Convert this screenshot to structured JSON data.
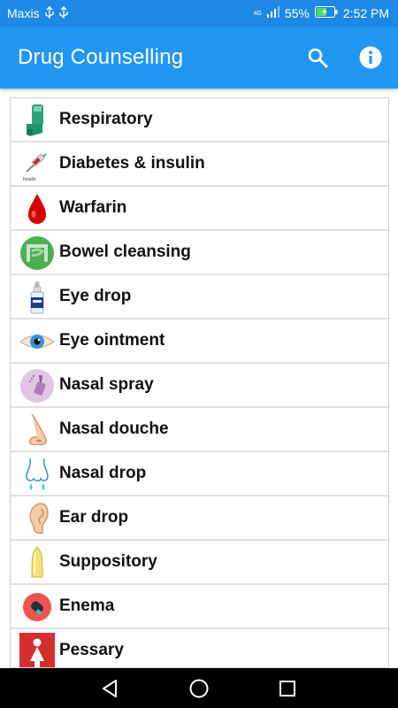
{
  "status_bar": {
    "carrier": "Maxis",
    "network_label": "4G",
    "battery_percent": "55%",
    "time": "2:52 PM",
    "icons": [
      "usb-icon",
      "usb-icon",
      "signal-icon",
      "battery-charging-icon"
    ]
  },
  "app_bar": {
    "title": "Drug Counselling",
    "background": "#2196F3",
    "actions": [
      "search-icon",
      "info-icon"
    ]
  },
  "list": {
    "items": [
      {
        "label": "Respiratory",
        "icon": "inhaler-icon"
      },
      {
        "label": "Diabetes & insulin",
        "icon": "insulin-syringe-icon",
        "icon_caption": "Insulin"
      },
      {
        "label": "Warfarin",
        "icon": "blood-drop-icon"
      },
      {
        "label": "Bowel cleansing",
        "icon": "intestine-icon"
      },
      {
        "label": "Eye drop",
        "icon": "eye-drop-bottle-icon"
      },
      {
        "label": "Eye ointment",
        "icon": "eye-icon"
      },
      {
        "label": "Nasal spray",
        "icon": "nasal-spray-icon"
      },
      {
        "label": "Nasal douche",
        "icon": "nose-icon"
      },
      {
        "label": "Nasal drop",
        "icon": "nose-drop-icon"
      },
      {
        "label": "Ear drop",
        "icon": "ear-icon"
      },
      {
        "label": "Suppository",
        "icon": "suppository-icon"
      },
      {
        "label": "Enema",
        "icon": "enema-icon"
      },
      {
        "label": "Pessary",
        "icon": "pessary-icon"
      }
    ]
  },
  "nav_bar": {
    "buttons": [
      "back-icon",
      "home-icon",
      "recents-icon"
    ]
  }
}
